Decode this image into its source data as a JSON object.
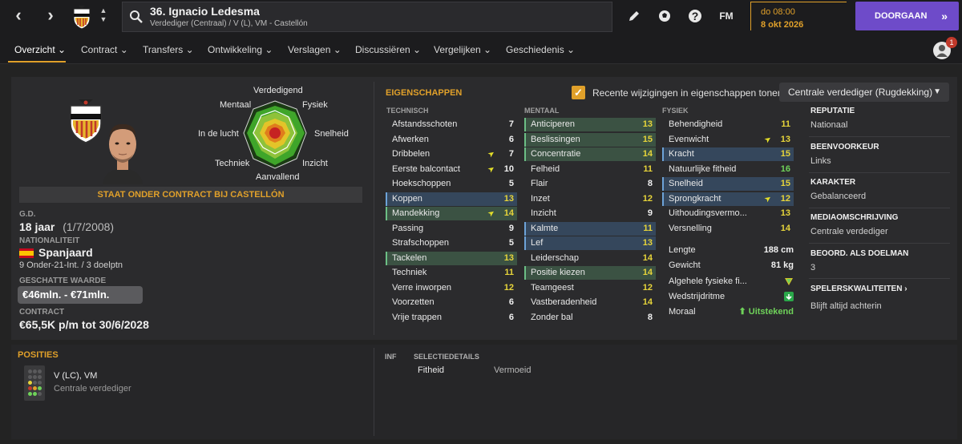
{
  "player": {
    "title": "36. Ignacio Ledesma",
    "subtitle": "Verdediger (Centraal) / V (L), VM - Castellón"
  },
  "topbar": {
    "time": "do 08:00",
    "date": "8 okt 2026",
    "continue_label": "DOORGAAN",
    "fm_label": "FM",
    "help_label": "?"
  },
  "tabs": [
    {
      "label": "Overzicht"
    },
    {
      "label": "Contract"
    },
    {
      "label": "Transfers"
    },
    {
      "label": "Ontwikkeling"
    },
    {
      "label": "Verslagen"
    },
    {
      "label": "Discussiëren"
    },
    {
      "label": "Vergelijken"
    },
    {
      "label": "Geschiedenis"
    }
  ],
  "notification_count": "1",
  "radar_labels": {
    "top": "Verdedigend",
    "top_left": "Mentaal",
    "top_right": "Fysiek",
    "left": "In de lucht",
    "right": "Snelheid",
    "bottom_left": "Techniek",
    "bottom_right": "Inzicht",
    "bottom": "Aanvallend"
  },
  "profile": {
    "contract_banner": "STAAT ONDER CONTRACT BIJ CASTELLÓN",
    "age_label": "G.D.",
    "age_value": "18 jaar",
    "dob": "(1/7/2008)",
    "nationality_label": "NATIONALITEIT",
    "nationality": "Spanjaard",
    "caps": "9 Onder-21-Int. / 3 doelptn",
    "value_label": "GESCHATTE WAARDE",
    "value": "€46mln. - €71mln.",
    "contract_label": "CONTRACT",
    "contract": "€65,5K p/m tot 30/6/2028"
  },
  "attributes": {
    "title": "EIGENSCHAPPEN",
    "recent_changes_label": "Recente wijzigingen in eigenschappen tonen",
    "role": "Centrale verdediger (Rugdekking)",
    "technical_head": "TECHNISCH",
    "mental_head": "MENTAAL",
    "physical_head": "FYSIEK",
    "technical": [
      {
        "name": "Afstandsschoten",
        "value": "7",
        "hl": "",
        "arrow": false,
        "color": "white"
      },
      {
        "name": "Afwerken",
        "value": "6",
        "hl": "",
        "arrow": false,
        "color": "white"
      },
      {
        "name": "Dribbelen",
        "value": "7",
        "hl": "",
        "arrow": true,
        "color": "white"
      },
      {
        "name": "Eerste balcontact",
        "value": "10",
        "hl": "",
        "arrow": true,
        "color": "white"
      },
      {
        "name": "Hoekschoppen",
        "value": "5",
        "hl": "",
        "arrow": false,
        "color": "white"
      },
      {
        "name": "Koppen",
        "value": "13",
        "hl": "blue",
        "arrow": false,
        "color": "yellow"
      },
      {
        "name": "Mandekking",
        "value": "14",
        "hl": "green",
        "arrow": true,
        "color": "yellow"
      },
      {
        "name": "Passing",
        "value": "9",
        "hl": "",
        "arrow": false,
        "color": "white"
      },
      {
        "name": "Strafschoppen",
        "value": "5",
        "hl": "",
        "arrow": false,
        "color": "white"
      },
      {
        "name": "Tackelen",
        "value": "13",
        "hl": "green",
        "arrow": false,
        "color": "yellow"
      },
      {
        "name": "Techniek",
        "value": "11",
        "hl": "",
        "arrow": false,
        "color": "yellow"
      },
      {
        "name": "Verre inworpen",
        "value": "12",
        "hl": "",
        "arrow": false,
        "color": "yellow"
      },
      {
        "name": "Voorzetten",
        "value": "6",
        "hl": "",
        "arrow": false,
        "color": "white"
      },
      {
        "name": "Vrije trappen",
        "value": "6",
        "hl": "",
        "arrow": false,
        "color": "white"
      }
    ],
    "mental": [
      {
        "name": "Anticiperen",
        "value": "13",
        "hl": "green",
        "arrow": false,
        "color": "yellow"
      },
      {
        "name": "Beslissingen",
        "value": "15",
        "hl": "green",
        "arrow": false,
        "color": "yellow"
      },
      {
        "name": "Concentratie",
        "value": "14",
        "hl": "green",
        "arrow": false,
        "color": "yellow"
      },
      {
        "name": "Felheid",
        "value": "11",
        "hl": "",
        "arrow": false,
        "color": "yellow"
      },
      {
        "name": "Flair",
        "value": "8",
        "hl": "",
        "arrow": false,
        "color": "white"
      },
      {
        "name": "Inzet",
        "value": "12",
        "hl": "",
        "arrow": false,
        "color": "yellow"
      },
      {
        "name": "Inzicht",
        "value": "9",
        "hl": "",
        "arrow": false,
        "color": "white"
      },
      {
        "name": "Kalmte",
        "value": "11",
        "hl": "blue",
        "arrow": false,
        "color": "yellow"
      },
      {
        "name": "Lef",
        "value": "13",
        "hl": "blue",
        "arrow": false,
        "color": "yellow"
      },
      {
        "name": "Leiderschap",
        "value": "14",
        "hl": "",
        "arrow": false,
        "color": "yellow"
      },
      {
        "name": "Positie kiezen",
        "value": "14",
        "hl": "green",
        "arrow": false,
        "color": "yellow"
      },
      {
        "name": "Teamgeest",
        "value": "12",
        "hl": "",
        "arrow": false,
        "color": "yellow"
      },
      {
        "name": "Vastberadenheid",
        "value": "14",
        "hl": "",
        "arrow": false,
        "color": "yellow"
      },
      {
        "name": "Zonder bal",
        "value": "8",
        "hl": "",
        "arrow": false,
        "color": "white"
      }
    ],
    "physical": [
      {
        "name": "Behendigheid",
        "value": "11",
        "hl": "",
        "arrow": false,
        "color": "yellow"
      },
      {
        "name": "Evenwicht",
        "value": "13",
        "hl": "",
        "arrow": true,
        "color": "yellow"
      },
      {
        "name": "Kracht",
        "value": "15",
        "hl": "blue",
        "arrow": false,
        "color": "yellow"
      },
      {
        "name": "Natuurlijke fitheid",
        "value": "16",
        "hl": "",
        "arrow": false,
        "color": "green"
      },
      {
        "name": "Snelheid",
        "value": "15",
        "hl": "blue",
        "arrow": false,
        "color": "yellow"
      },
      {
        "name": "Sprongkracht",
        "value": "12",
        "hl": "blue",
        "arrow": true,
        "color": "yellow"
      },
      {
        "name": "Uithoudingsvermo...",
        "value": "13",
        "hl": "",
        "arrow": false,
        "color": "yellow"
      },
      {
        "name": "Versnelling",
        "value": "14",
        "hl": "",
        "arrow": false,
        "color": "yellow"
      }
    ],
    "extras": {
      "length_label": "Lengte",
      "length": "188 cm",
      "weight_label": "Gewicht",
      "weight": "81 kg",
      "fitness_label": "Algehele fysieke fi...",
      "match_fitness_label": "Wedstrijdritme",
      "morale_label": "Moraal",
      "morale": "Uitstekend"
    }
  },
  "side_info": {
    "reputation_label": "REPUTATIE",
    "reputation": "Nationaal",
    "foot_label": "BEENVOORKEUR",
    "foot": "Links",
    "character_label": "KARAKTER",
    "character": "Gebalanceerd",
    "media_label": "MEDIAOMSCHRIJVING",
    "media": "Centrale verdediger",
    "gk_label": "BEOORD. ALS DOELMAN",
    "gk": "3",
    "traits_label": "SPELERSKWALITEITEN",
    "traits": "Blijft altijd achterin"
  },
  "positions": {
    "title": "POSITIES",
    "main": "V (LC), VM",
    "sub": "Centrale verdediger"
  },
  "selection": {
    "inf_label": "INF",
    "details_label": "SELECTIEDETAILS",
    "fitness_label": "Fitheid",
    "fitness_value": "Vermoeid"
  }
}
